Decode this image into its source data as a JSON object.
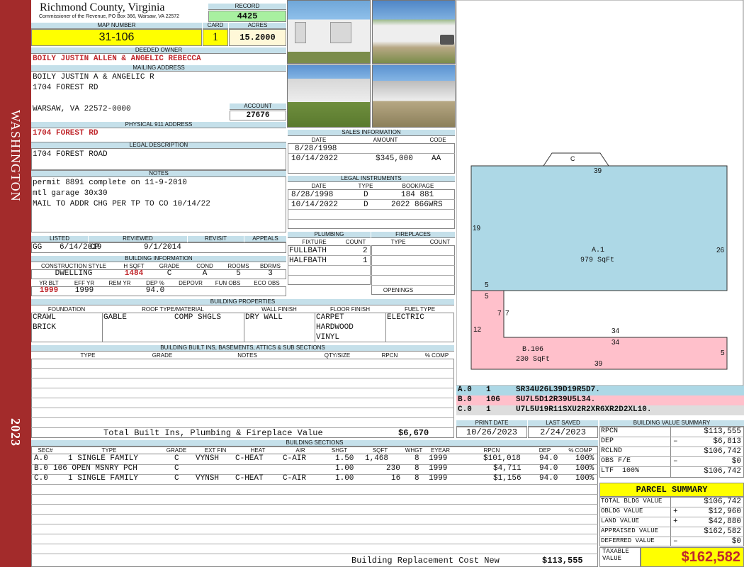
{
  "sidebar": {
    "district": "WASHINGTON",
    "year": "2023"
  },
  "header": {
    "county": "Richmond County, Virginia",
    "commissioner": "Commissioner of the Revenue, PO Box 366, Warsaw, VA 22572",
    "record_label": "RECORD",
    "record": "4425",
    "map_label": "MAP NUMBER",
    "map": "31-106",
    "card_label": "CARD",
    "card": "1",
    "acres_label": "ACRES",
    "acres": "15.2000"
  },
  "owner": {
    "deeded_label": "DEEDED OWNER",
    "deeded": "BOILY JUSTIN ALLEN & ANGELIC REBECCA",
    "mailing_label": "MAILING ADDRESS",
    "mail1": "BOILY JUSTIN A & ANGELIC R",
    "mail2": "1704 FOREST RD",
    "mail3": "WARSAW, VA 22572-0000",
    "account_label": "ACCOUNT",
    "account": "27676",
    "address_label": "PHYSICAL 911 ADDRESS",
    "address": "1704 FOREST RD",
    "legal_label": "LEGAL DESCRIPTION",
    "legal": "1704 FOREST ROAD",
    "notes_label": "NOTES",
    "notes": [
      "permit 8891 complete on 11-9-2010",
      "mtl garage 30x30",
      "MAIL TO ADDR CHG PER TP TO CO 10/14/22"
    ]
  },
  "review": {
    "listed_label": "LISTED",
    "reviewed_label": "REVIEWED",
    "revisit_label": "REVISIT",
    "appeals_label": "APPEALS",
    "listed_by": "GG",
    "listed_date": "6/14/2019",
    "reviewed_by": "CP",
    "reviewed_date": "9/1/2014"
  },
  "building_info": {
    "label": "BUILDING INFORMATION",
    "h": [
      "CONSTRUCTION STYLE",
      "H SQFT",
      "GRADE",
      "COND",
      "ROOMS",
      "BDRMS"
    ],
    "v": [
      "DWELLING",
      "1484",
      "C",
      "A",
      "5",
      "3"
    ],
    "h2": [
      "YR BLT",
      "EFF YR",
      "REM YR",
      "DEP %",
      "DEPOVR",
      "FUN OBS",
      "ECO OBS"
    ],
    "v2": [
      "1999",
      "1999",
      "",
      "94.0",
      "",
      "",
      ""
    ]
  },
  "properties": {
    "label": "BUILDING PROPERTIES",
    "foundation_label": "FOUNDATION",
    "roof_label": "ROOF TYPE/MATERIAL",
    "wall_label": "WALL FINISH",
    "floor_label": "FLOOR FINISH",
    "fuel_label": "FUEL TYPE",
    "foundation": [
      "CRAWL",
      "BRICK"
    ],
    "roof1": "GABLE",
    "roof2": "COMP SHGLS",
    "wall": "DRY WALL",
    "floor": [
      "CARPET",
      "HARDWOOD",
      "VINYL"
    ],
    "fuel": "ELECTRIC"
  },
  "builtins": {
    "label": "BUILDING BUILT INS, BASEMENTS, ATTICS & SUB SECTIONS",
    "cols": [
      "TYPE",
      "GRADE",
      "NOTES",
      "QTY/SIZE",
      "RPCN",
      "% COMP"
    ],
    "total_label": "Total Built Ins, Plumbing & Fireplace Value",
    "total": "$6,670"
  },
  "sales": {
    "label": "SALES INFORMATION",
    "cols": [
      "DATE",
      "AMOUNT",
      "CODE"
    ],
    "rows": [
      [
        "8/28/1998",
        "",
        ""
      ],
      [
        "10/14/2022",
        "$345,000",
        "AA"
      ]
    ]
  },
  "instruments": {
    "label": "LEGAL INSTRUMENTS",
    "cols": [
      "DATE",
      "TYPE",
      "BOOKPAGE"
    ],
    "rows": [
      [
        "8/28/1998",
        "D",
        "184 881"
      ],
      [
        "10/14/2022",
        "D",
        "2022 866WRS"
      ]
    ]
  },
  "plumbing": {
    "label": "PLUMBING",
    "cols": [
      "FIXTURE",
      "COUNT"
    ],
    "rows": [
      [
        "FULLBATH",
        "2"
      ],
      [
        "HALFBATH",
        "1"
      ]
    ],
    "fire_label": "FIREPLACES",
    "fire_cols": [
      "TYPE",
      "COUNT"
    ],
    "openings_label": "OPENINGS"
  },
  "sketch": {
    "top_label": "C",
    "a_label": "A.1",
    "a_area": "979 SqFt",
    "b_label": "B.106",
    "b_area": "230 SqFt",
    "d39": "39",
    "d19": "19",
    "d26": "26",
    "d5a": "5",
    "d5b": "5",
    "d7a": "7",
    "d7b": "7",
    "d12": "12",
    "d34a": "34",
    "d34b": "34",
    "d5c": "5",
    "d39b": "39"
  },
  "sketch_codes": [
    [
      "A.0",
      "1",
      "SR34U26L39D19R5D7."
    ],
    [
      "B.0",
      "106",
      "SU7L5D12R39U5L34."
    ],
    [
      "C.0",
      "1",
      "U7L5U19R11SXU2R2XR6XR2D2XL10."
    ]
  ],
  "dates": {
    "print_label": "PRINT DATE",
    "saved_label": "LAST SAVED",
    "print": "10/26/2023",
    "saved": "2/24/2023"
  },
  "sections": {
    "label": "BUILDING SECTIONS",
    "cols": [
      "SEC#",
      "TYPE",
      "GRADE",
      "EXT FIN",
      "HEAT",
      "AIR",
      "SHGT",
      "SQFT",
      "WHGT",
      "EYEAR",
      "RPCN",
      "DEP",
      "% COMP"
    ],
    "rows": [
      [
        "A.0",
        "1 SINGLE FAMILY",
        "C",
        "VYNSH",
        "C-HEAT",
        "C-AIR",
        "1.50",
        "1,468",
        "8",
        "1999",
        "$101,018",
        "94.0",
        "100%"
      ],
      [
        "B.0",
        "106 OPEN MSNRY PCH",
        "C",
        "",
        "",
        "",
        "1.00",
        "230",
        "8",
        "1999",
        "$4,711",
        "94.0",
        "100%"
      ],
      [
        "C.0",
        "1 SINGLE FAMILY",
        "C",
        "VYNSH",
        "C-HEAT",
        "C-AIR",
        "1.00",
        "16",
        "8",
        "1999",
        "$1,156",
        "94.0",
        "100%"
      ]
    ],
    "replacement_label": "Building Replacement Cost New",
    "replacement": "$113,555"
  },
  "value_summary": {
    "label": "BUILDING VALUE SUMMARY",
    "rows": [
      [
        "RPCN",
        "",
        "$113,555"
      ],
      [
        "DEP",
        "–",
        "$6,813"
      ],
      [
        "RCLND",
        "",
        "$106,742"
      ],
      [
        "OBS F/E",
        "–",
        "$0"
      ],
      [
        "LTF  100%",
        "",
        "$106,742"
      ]
    ]
  },
  "parcel": {
    "label": "PARCEL SUMMARY",
    "rows": [
      [
        "TOTAL BLDG VALUE",
        "",
        "$106,742"
      ],
      [
        "OBLDG VALUE",
        "+",
        "$12,960"
      ],
      [
        "LAND VALUE",
        "+",
        "$42,880"
      ],
      [
        "APPRAISED VALUE",
        "",
        "$162,582"
      ],
      [
        "DEFERRED VALUE",
        "–",
        "$0"
      ]
    ],
    "taxable_label": "TAXABLE VALUE",
    "taxable": "$162,582"
  }
}
